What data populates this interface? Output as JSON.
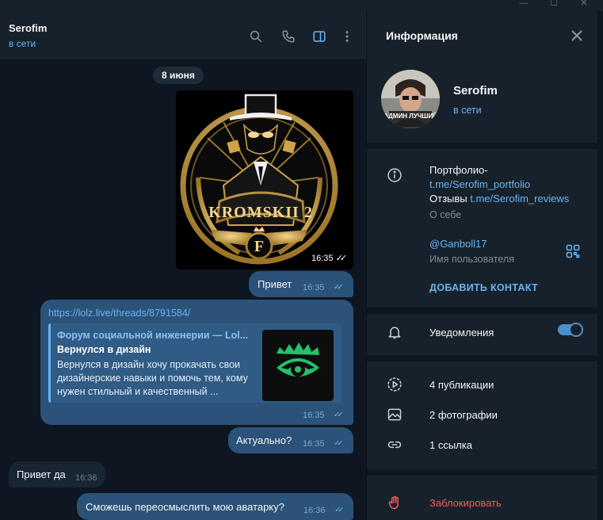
{
  "chat": {
    "title": "Serofim",
    "status": "в сети",
    "date_separator": "8 июня",
    "messages": [
      {
        "type": "photo",
        "time": "16:35"
      },
      {
        "type": "text",
        "text": "Привет",
        "time": "16:35"
      },
      {
        "type": "link",
        "url": "https://lolz.live/threads/8791584/",
        "preview_site": "Форум социальной инженерии — Lol...",
        "preview_title": "Вернулся в дизайн",
        "preview_description": "Вернулся в дизайн хочу прокачать свои дизайнерские навыки и помочь тем, кому нужен стильный и качественный ...",
        "time": "16:35"
      },
      {
        "type": "text",
        "text": "Актуально?",
        "time": "16:35"
      },
      {
        "type": "incoming",
        "text": "Привет да",
        "time": "16:36"
      },
      {
        "type": "text",
        "text": "Сможешь переосмыслить мою аватарку?",
        "time": "16:36"
      }
    ],
    "photo_caption_art": "KROMSKII 2",
    "header_icons": [
      "search-icon",
      "phone-icon",
      "sidebar-toggle-icon",
      "more-vertical-icon"
    ]
  },
  "info": {
    "title": "Информация",
    "name": "Serofim",
    "status": "в сети",
    "avatar_text": "АДМИН ЛУЧШИЙ",
    "bio_line1": "Портфолио-",
    "bio_link1": "t.me/Serofim_portfolio",
    "bio_line2": "Отзывы",
    "bio_link2": "t.me/Serofim_reviews",
    "bio_label": "О себе",
    "username": "@Ganboll17",
    "username_label": "Имя пользователя",
    "add_contact": "ДОБАВИТЬ КОНТАКТ",
    "notifications": "Уведомления",
    "notifications_on": true,
    "publications": "4 публикации",
    "photos": "2 фотографии",
    "links": "1 ссылка",
    "block": "Заблокировать"
  },
  "colors": {
    "accent": "#6ab3f3",
    "bubble_out": "#2b5278",
    "bubble_in": "#182533",
    "danger": "#f55a5a"
  }
}
